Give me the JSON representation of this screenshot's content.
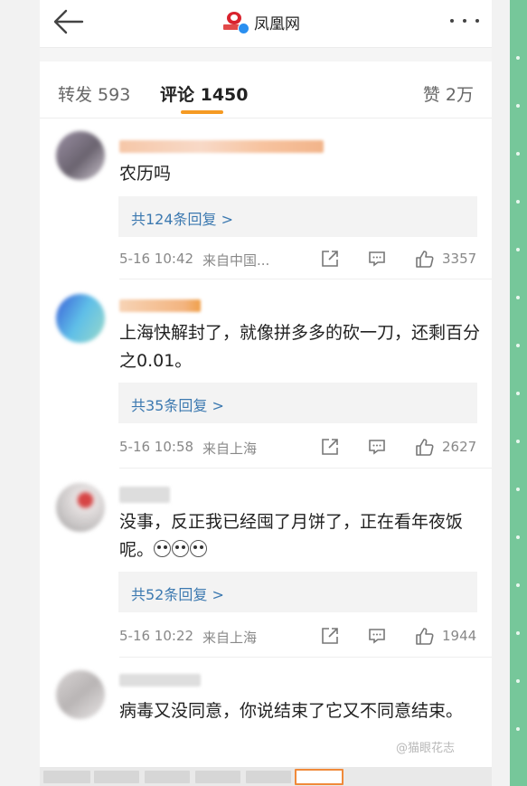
{
  "header": {
    "title": "凤凰网",
    "back_icon": "arrow-left-icon",
    "more_icon": "more-dots-icon",
    "brand_color": "#d9232e",
    "verified_color": "#2a8ff0"
  },
  "tabs": {
    "repost": "转发 593",
    "comment": "评论 1450",
    "like": "赞 2万",
    "active_color": "#f59a23"
  },
  "comments": [
    {
      "text": "农历吗",
      "reply_label": "共124条回复 >",
      "time": "5-16 10:42",
      "source": "来自中国...",
      "likes": "3357"
    },
    {
      "text": "上海快解封了，就像拼多多的砍一刀，还剩百分之0.01。",
      "reply_label": "共35条回复 >",
      "time": "5-16 10:58",
      "source": "来自上海",
      "likes": "2627"
    },
    {
      "text": "没事，反正我已经囤了月饼了，正在看年夜饭呢。",
      "reply_label": "共52条回复 >",
      "time": "5-16 10:22",
      "source": "来自上海",
      "likes": "1944"
    },
    {
      "text": "病毒又没同意，你说结束了它又不同意结束。"
    }
  ],
  "watermark": "@猫眼花志"
}
